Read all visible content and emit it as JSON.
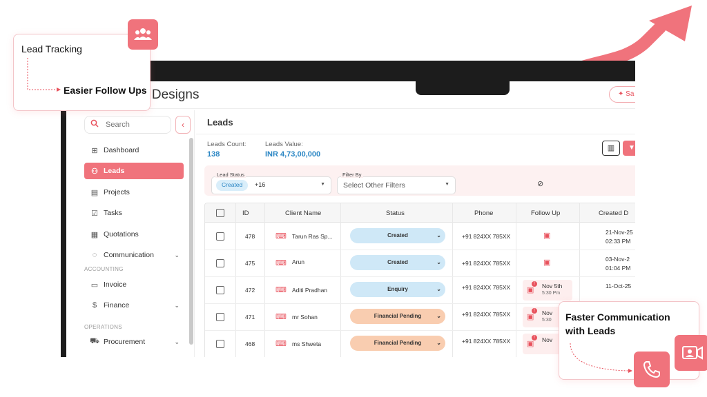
{
  "brand": {
    "title": "e Designs",
    "top_button": "Sa"
  },
  "sidebar": {
    "search_placeholder": "Search",
    "collapse_glyph": "‹",
    "items": [
      {
        "label": "Dashboard",
        "icon": "grid-icon",
        "glyph": "⊞"
      },
      {
        "label": "Leads",
        "icon": "leads-icon",
        "glyph": "⚇"
      },
      {
        "label": "Projects",
        "icon": "projects-icon",
        "glyph": "▤"
      },
      {
        "label": "Tasks",
        "icon": "tasks-icon",
        "glyph": "☑"
      },
      {
        "label": "Quotations",
        "icon": "quotations-icon",
        "glyph": "▦"
      },
      {
        "label": "Communication",
        "icon": "chat-icon",
        "glyph": "◌"
      },
      {
        "label": "Invoice",
        "icon": "invoice-icon",
        "glyph": "▭"
      },
      {
        "label": "Finance",
        "icon": "finance-icon",
        "glyph": "$"
      },
      {
        "label": "Procurement",
        "icon": "cart-icon",
        "glyph": "⛟"
      }
    ],
    "section_accounting": "ACCOUNTING",
    "section_operations": "OPERATIONS"
  },
  "main": {
    "title": "Leads",
    "leads_count_label": "Leads Count:",
    "leads_count_value": "138",
    "leads_value_label": "Leads Value:",
    "leads_value_value": "INR 4,73,00,000",
    "lead_status_label": "Lead Status",
    "lead_status_chip": "Created",
    "lead_status_more": "+16",
    "filter_by_label": "Filter By",
    "filter_by_placeholder": "Select Other Filters"
  },
  "table": {
    "headers": [
      "ID",
      "Client Name",
      "Status",
      "Phone",
      "Follow Up",
      "Created D"
    ],
    "rows": [
      {
        "id": "478",
        "name": "Tarun Ras Sp...",
        "status": "Created",
        "phone": "+91 824XX 785XX",
        "follow_date": "",
        "follow_time": "",
        "created_date": "21-Nov-25",
        "created_time": "02:33 PM"
      },
      {
        "id": "475",
        "name": "Arun",
        "status": "Created",
        "phone": "+91 824XX 785XX",
        "follow_date": "",
        "follow_time": "",
        "created_date": "03-Nov-2",
        "created_time": "01:04 PM"
      },
      {
        "id": "472",
        "name": "Aditi Pradhan",
        "status": "Enquiry",
        "phone": "+91 824XX 785XX",
        "follow_date": "Nov 5th",
        "follow_time": "5:30 Pm",
        "created_date": "11-Oct-25",
        "created_time": ""
      },
      {
        "id": "471",
        "name": "mr Sohan",
        "status": "Financial Pending",
        "phone": "+91 824XX 785XX",
        "follow_date": "Nov",
        "follow_time": "5:30",
        "created_date": "",
        "created_time": ""
      },
      {
        "id": "468",
        "name": "ms Shweta",
        "status": "Financial Pending",
        "phone": "+91 824XX 785XX",
        "follow_date": "Nov",
        "follow_time": "",
        "created_date": "",
        "created_time": ""
      }
    ]
  },
  "callouts": {
    "lead_tracking": "Lead Tracking",
    "easier_follow_ups": "Easier Follow Ups",
    "faster_communication": "Faster Communication with Leads"
  },
  "colors": {
    "accent": "#f0737c",
    "status_blue": "#cfe8f7",
    "status_orange": "#f9cdb0",
    "link_blue": "#2a86c4"
  }
}
